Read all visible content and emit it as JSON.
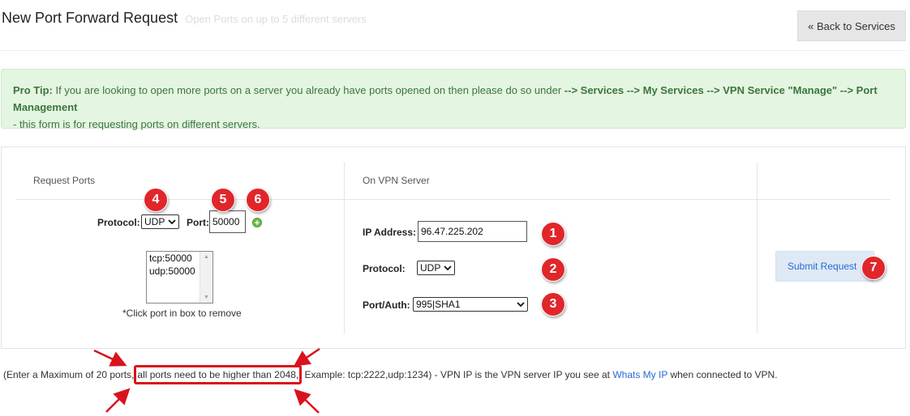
{
  "header": {
    "title": "New Port Forward Request",
    "subtitle": "Open Ports on up to 5 different servers",
    "back_label": "« Back to Services"
  },
  "tip": {
    "lead": "Pro Tip:",
    "text1": " If you are looking to open more ports on a server you already have ports opened on then please do so under ",
    "path": "--> Services --> My Services --> VPN Service \"Manage\" --> Port Management",
    "text2": "- this form is for requesting ports on different servers."
  },
  "request_ports": {
    "heading": "Request Ports",
    "protocol_label": "Protocol:",
    "protocol_value": "UDP",
    "port_label": "Port:",
    "port_value": "50000",
    "ports_list": [
      "tcp:50000",
      "udp:50000"
    ],
    "remove_note": "*Click port in box to remove"
  },
  "vpn_server": {
    "heading": "On VPN Server",
    "ip_label": "IP Address:",
    "ip_value": "96.47.225.202",
    "protocol_label": "Protocol:",
    "protocol_value": "UDP",
    "portauth_label": "Port/Auth:",
    "portauth_value": "995|SHA1"
  },
  "submit_label": "Submit Request",
  "badges": [
    "1",
    "2",
    "3",
    "4",
    "5",
    "6",
    "7"
  ],
  "footer": {
    "pre": "(Enter a Maximum of 20 ports,",
    "highlight": "all ports need to be higher than 2048,",
    "post": " Example: tcp:2222,udp:1234) - VPN IP is the VPN server IP you see at ",
    "link": "Whats My IP",
    "tail": " when connected to VPN."
  },
  "colors": {
    "badge": "#e0262b",
    "link": "#2a6ad3",
    "tip_bg": "#e4f5e1",
    "tip_text": "#3c763d",
    "annotation": "#d9131d"
  },
  "icons": [
    "add-port-icon",
    "dropdown-caret-icon",
    "annotation-arrow-icon"
  ]
}
